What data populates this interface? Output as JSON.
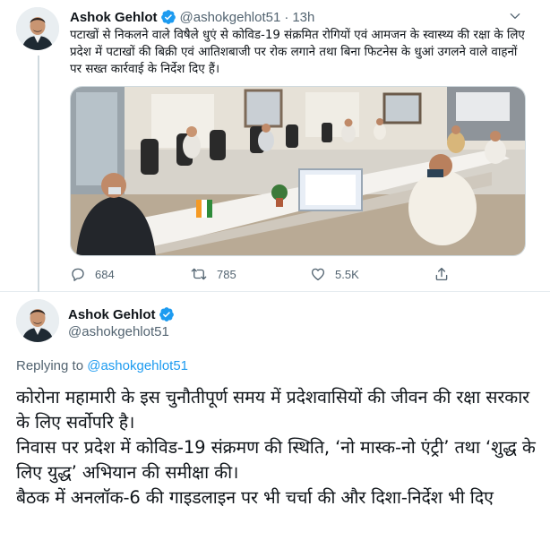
{
  "tweet": {
    "author_name": "Ashok Gehlot",
    "handle": "@ashokgehlot51",
    "separator": "·",
    "time": "13h",
    "text": "पटाखों से निकलने वाले विषैले धुएं से कोविड-19 संक्रमित रोगियों एवं आमजन के स्वास्थ्य की रक्षा के लिए प्रदेश में पटाखों की बिक्री एवं आतिशबाजी पर रोक लगाने तथा बिना फिटनेस के धुआं उगलने वाले वाहनों पर सख्त कार्रवाई के निर्देश दिए हैं।",
    "replies": "684",
    "retweets": "785",
    "likes": "5.5K"
  },
  "reply": {
    "author_name": "Ashok Gehlot",
    "handle": "@ashokgehlot51",
    "replying_prefix": "Replying to",
    "replying_to": "@ashokgehlot51",
    "lines": [
      "कोरोना महामारी के इस चुनौतीपूर्ण समय में प्रदेशवासियों की जीवन की रक्षा सरकार के लिए सर्वोपरि है।",
      "निवास पर प्रदेश में कोविड-19 संक्रमण की स्थिति, ‘नो मास्क-नो एंट्री’ तथा ‘शुद्ध के लिए युद्ध’ अभियान की समीक्षा की।",
      "बैठक में अनलॉक-6 की गाइडलाइन पर भी चर्चा की और दिशा-निर्देश भी दिए"
    ]
  },
  "colors": {
    "accent": "#1d9bf0",
    "secondary_text": "#536471",
    "border": "#cfd9de"
  },
  "icons": {
    "verified": "verified-badge-icon",
    "more": "chevron-down-icon",
    "reply": "reply-icon",
    "retweet": "retweet-icon",
    "like": "heart-icon",
    "share": "share-icon"
  }
}
